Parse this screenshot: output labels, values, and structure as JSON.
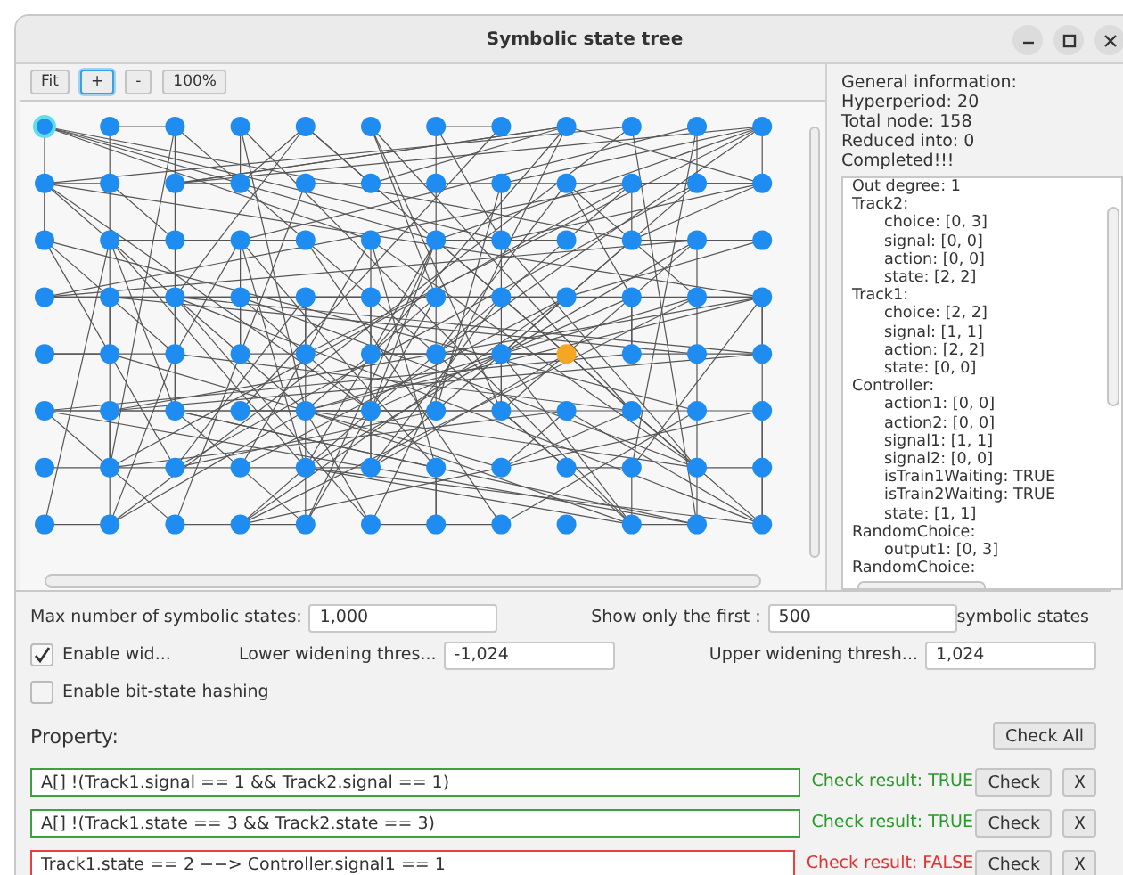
{
  "window": {
    "title": "Symbolic state tree"
  },
  "toolbar": [
    {
      "label": "Fit",
      "selected": false
    },
    {
      "label": "+",
      "selected": true
    },
    {
      "label": "-",
      "selected": false
    },
    {
      "label": "100%",
      "selected": false
    }
  ],
  "info": [
    "General information:",
    "Hyperperiod: 20",
    "Total node: 158",
    "Reduced into: 0",
    "Completed!!!"
  ],
  "state_tree": [
    {
      "text": "Out degree: 1"
    },
    {
      "text": "Track2:",
      "children": [
        {
          "text": "choice: [0, 3]"
        },
        {
          "text": "signal: [0, 0]"
        },
        {
          "text": "action: [0, 0]"
        },
        {
          "text": "state: [2, 2]"
        }
      ]
    },
    {
      "text": "Track1:",
      "children": [
        {
          "text": "choice: [2, 2]"
        },
        {
          "text": "signal: [1, 1]"
        },
        {
          "text": "action: [2, 2]"
        },
        {
          "text": "state: [0, 0]"
        }
      ]
    },
    {
      "text": "Controller:",
      "children": [
        {
          "text": "action1: [0, 0]"
        },
        {
          "text": "action2: [0, 0]"
        },
        {
          "text": "signal1: [1, 1]"
        },
        {
          "text": "signal2: [0, 0]"
        },
        {
          "text": "isTrain1Waiting: TRUE"
        },
        {
          "text": "isTrain2Waiting: TRUE"
        },
        {
          "text": "state: [1, 1]"
        }
      ]
    },
    {
      "text": "RandomChoice:",
      "children": [
        {
          "text": "output1: [0, 3]"
        }
      ]
    },
    {
      "text": "RandomChoice:"
    }
  ],
  "settings": {
    "max_label": "Max number of symbolic states:",
    "max_value": "1,000",
    "show_label": "Show only the first :",
    "show_value": "500",
    "show_suffix": "symbolic states",
    "widening": {
      "label": "Enable wid...",
      "checked": true
    },
    "lower_label": "Lower widening thres...",
    "lower_value": "-1,024",
    "upper_label": "Upper widening thresh...",
    "upper_value": "1,024",
    "hashing": {
      "label": "Enable bit-state hashing",
      "checked": false
    }
  },
  "property": {
    "title": "Property:",
    "check_all": "Check All",
    "items": [
      {
        "formula": "A[] !(Track1.signal == 1 && Track2.signal == 1)",
        "result": "Check result: TRUE",
        "passed": true,
        "check": "Check",
        "remove": "X"
      },
      {
        "formula": "A[] !(Track1.state == 3 && Track2.state == 3)",
        "result": "Check result: TRUE",
        "passed": true,
        "check": "Check",
        "remove": "X"
      },
      {
        "formula": "Track1.state == 2 −−> Controller.signal1 == 1",
        "result": "Check result: FALSE",
        "passed": false,
        "check": "Check",
        "remove": "X"
      }
    ]
  }
}
